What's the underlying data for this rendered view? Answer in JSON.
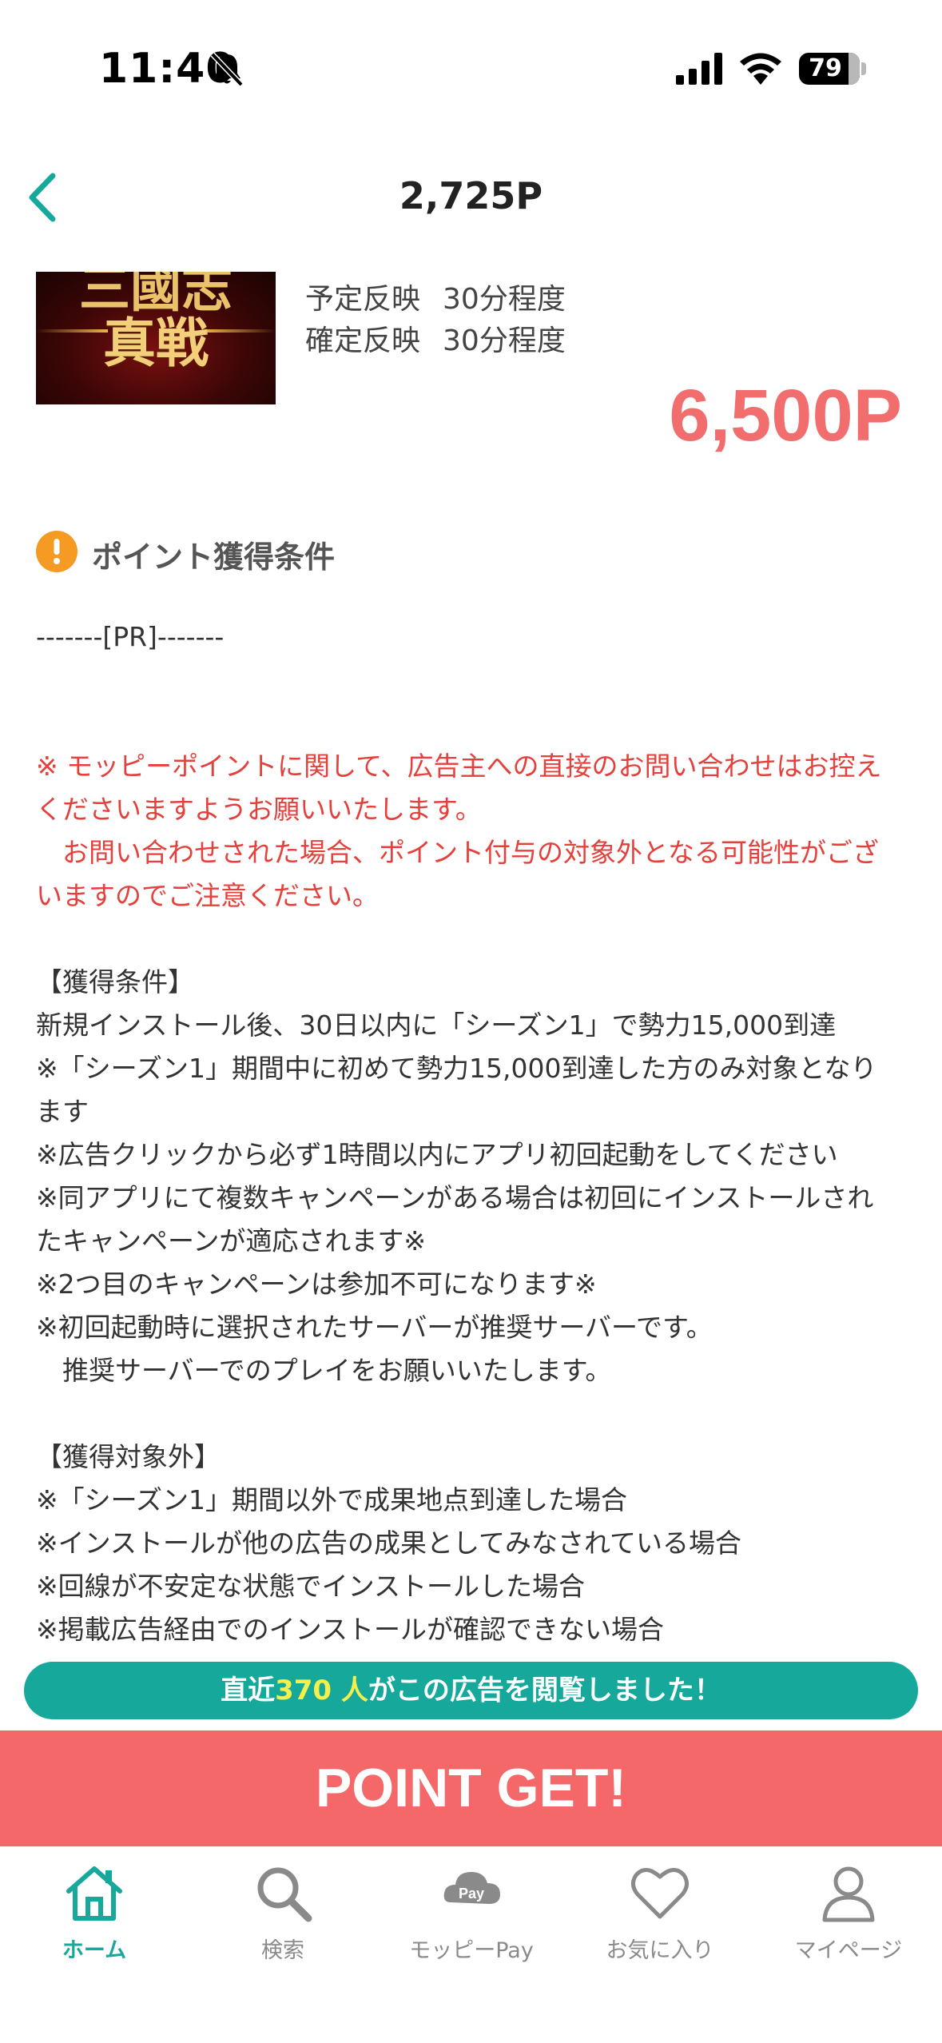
{
  "status": {
    "time": "11:40",
    "battery": "79"
  },
  "header": {
    "title": "2,725P"
  },
  "offer": {
    "banner_top": "三國志",
    "banner_main": "真戦",
    "scheduled_label": "予定反映",
    "scheduled_value": "30分程度",
    "confirmed_label": "確定反映",
    "confirmed_value": "30分程度",
    "points": "6,500P"
  },
  "section": {
    "title": "ポイント獲得条件"
  },
  "content": {
    "lines": [
      "-------[PR]-------",
      "",
      "",
      "※ モッピーポイントに関して、広告主への直接のお問い合わせはお控え",
      "くださいますようお願いいたします。",
      "　お問い合わせされた場合、ポイント付与の対象外となる可能性がござ",
      "いますのでご注意ください。",
      "",
      "【獲得条件】",
      "新規インストール後、30日以内に「シーズン1」で勢力15,000到達",
      "※「シーズン1」期間中に初めて勢力15,000到達した方のみ対象となり",
      "ます",
      "※広告クリックから必ず1時間以内にアプリ初回起動をしてください",
      "※同アプリにて複数キャンペーンがある場合は初回にインストールされ",
      "たキャンペーンが適応されます※",
      "※2つ目のキャンペーンは参加不可になります※",
      "※初回起動時に選択されたサーバーが推奨サーバーです。",
      "　推奨サーバーでのプレイをお願いいたします。",
      "",
      "【獲得対象外】",
      "※「シーズン1」期間以外で成果地点到達した場合",
      "※インストールが他の広告の成果としてみなされている場合",
      "※回線が不安定な状態でインストールした場合",
      "※掲載広告経由でのインストールが確認できない場合"
    ]
  },
  "viewers": {
    "prefix": "直近",
    "count": "370 人",
    "suffix": "がこの広告を閲覧しました！"
  },
  "cta": {
    "label": "POINT GET!"
  },
  "tabs": [
    {
      "label": "ホーム",
      "icon": "home-icon"
    },
    {
      "label": "検索",
      "icon": "search-icon"
    },
    {
      "label": "モッピーPay",
      "icon": "pay-icon"
    },
    {
      "label": "お気に入り",
      "icon": "heart-icon"
    },
    {
      "label": "マイページ",
      "icon": "person-icon"
    }
  ],
  "colors": {
    "accent": "#15a89b",
    "points": "#f26d6d",
    "cta": "#f5686a",
    "warning": "#e5403b",
    "highlight": "#f3ef4d"
  }
}
